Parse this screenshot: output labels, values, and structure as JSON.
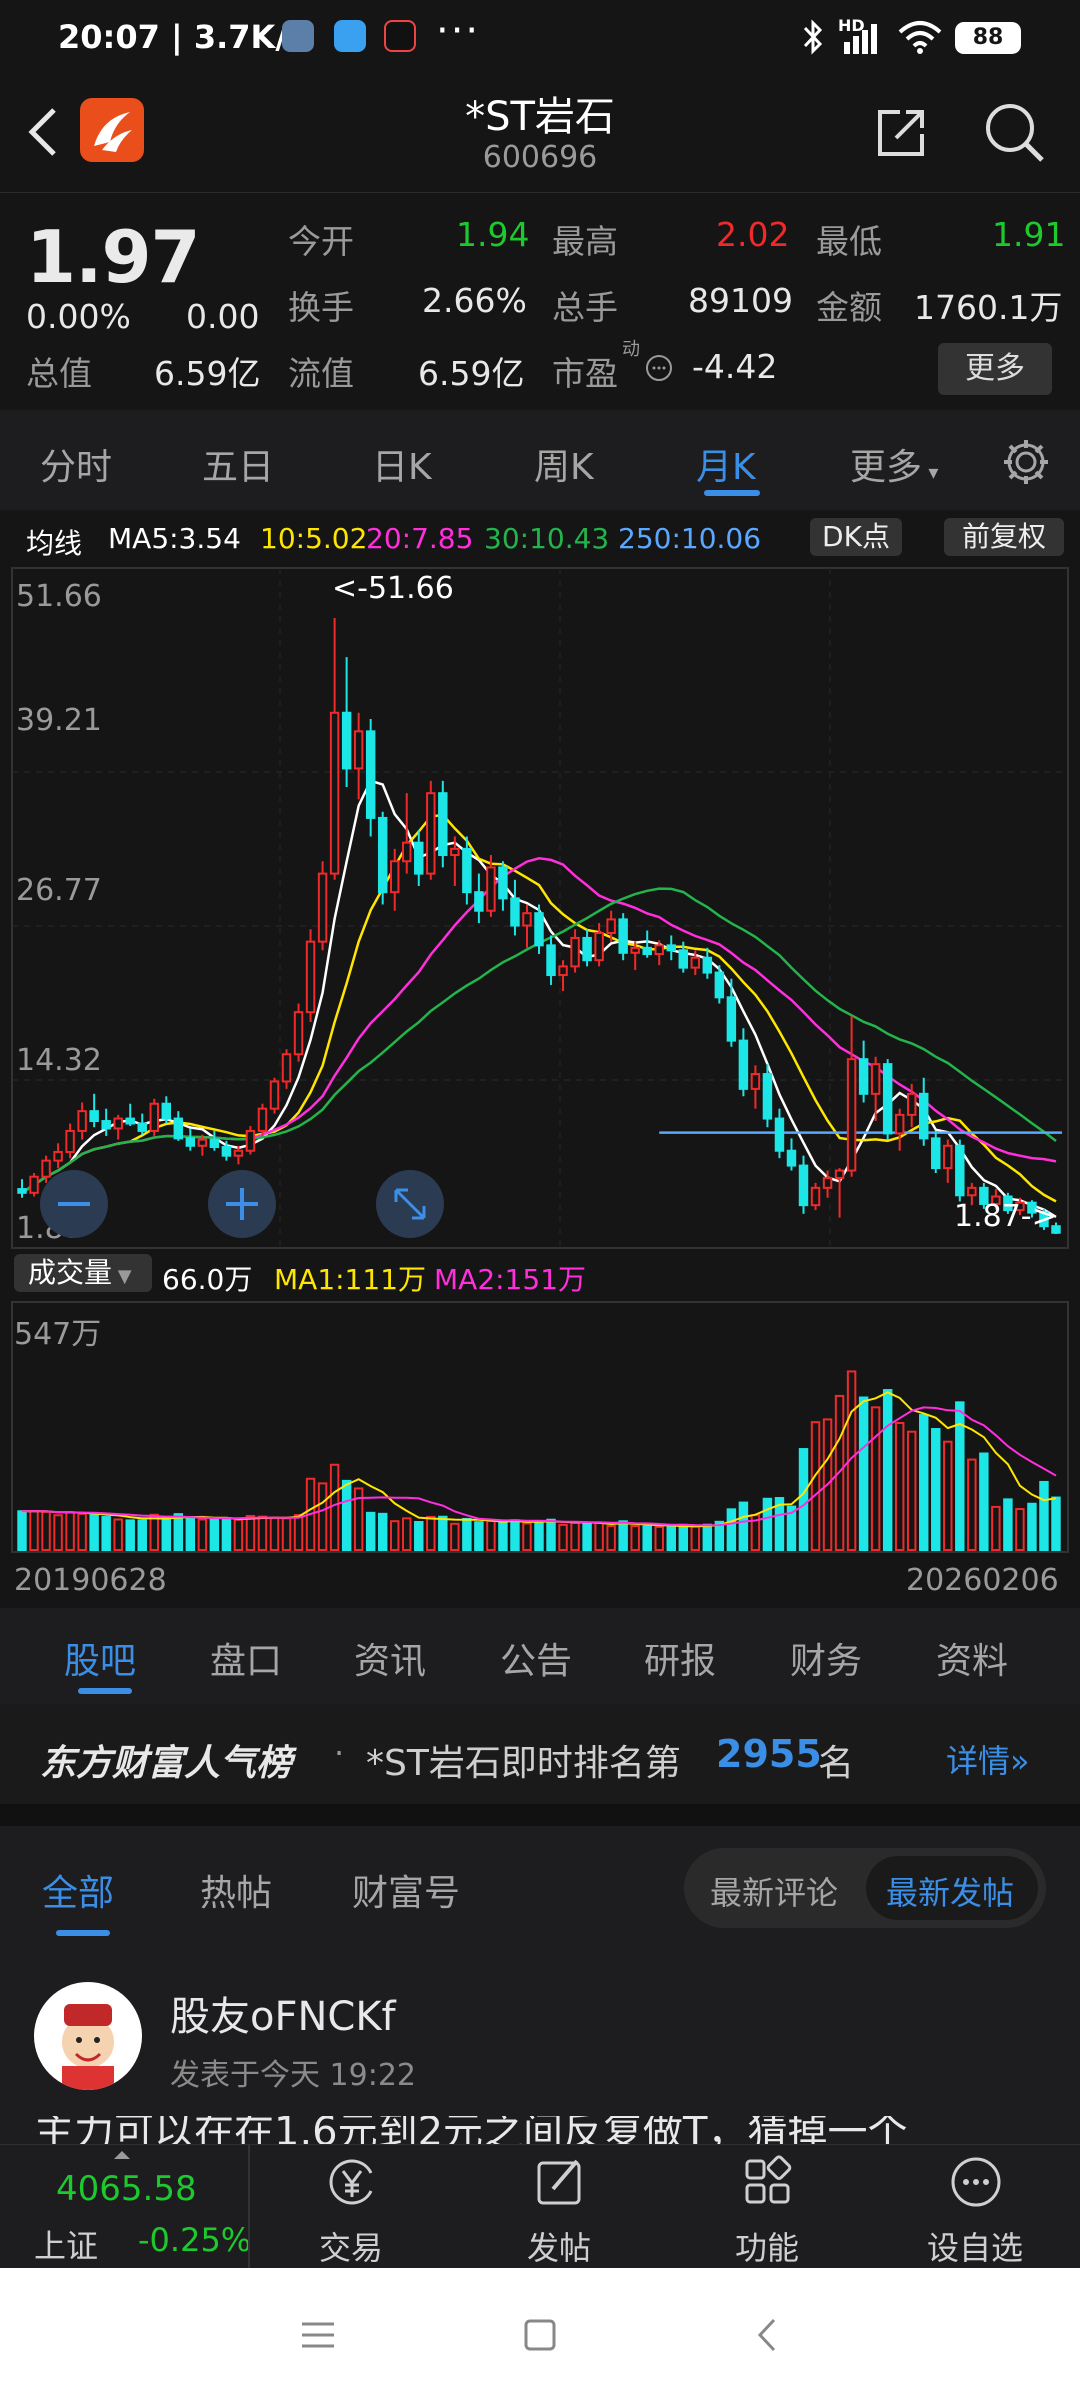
{
  "status": {
    "time": "20:07",
    "speed": "3.7K/s",
    "more": "···",
    "network": "HD",
    "battery": "88"
  },
  "header": {
    "title": "*ST岩石",
    "code": "600696"
  },
  "quote": {
    "price": "1.97",
    "change_pct": "0.00%",
    "change": "0.00",
    "open_label": "今开",
    "open": "1.94",
    "high_label": "最高",
    "high": "2.02",
    "low_label": "最低",
    "low": "1.91",
    "turnover_label": "换手",
    "turnover": "2.66%",
    "volume_label": "总手",
    "volume": "89109",
    "amount_label": "金额",
    "amount": "1760.1万",
    "total_cap_label": "总值",
    "total_cap": "6.59亿",
    "float_cap_label": "流值",
    "float_cap": "6.59亿",
    "pe_label": "市盈",
    "pe_sup": "动",
    "pe": "-4.42",
    "more_label": "更多"
  },
  "chart_tabs": [
    "分时",
    "五日",
    "日K",
    "周K",
    "月K",
    "更多"
  ],
  "chart_tab_active": "月K",
  "ma_legend": {
    "label": "均线",
    "ma5": "MA5:3.54",
    "ma10": "10:5.02",
    "ma20": "20:7.85",
    "ma30": "30:10.43",
    "ma250": "250:10.06",
    "dk_button": "DK点",
    "adjust_button": "前复权"
  },
  "kchart_axis": {
    "t1": "51.66",
    "t2": "39.21",
    "t3": "26.77",
    "t4": "14.32",
    "t5": "1.87",
    "max_mark": "<-51.66",
    "min_mark": "1.87->"
  },
  "volume_legend": {
    "label": "成交量",
    "value": "66.0万",
    "ma1": "MA1:111万",
    "ma2": "MA2:151万",
    "axis_max": "547万",
    "date_start": "20190628",
    "date_end": "20260206"
  },
  "colors": {
    "up": "#f02a2a",
    "down": "#1de6e6",
    "ma5": "#ffffff",
    "ma10": "#ffe600",
    "ma20": "#ff2fdc",
    "ma30": "#23b44b",
    "ma250": "#5aa8ff",
    "accent": "#3b8ee5"
  },
  "chart_data": {
    "type": "candlestick",
    "period": "monthly",
    "ylim": [
      1.87,
      51.66
    ],
    "max": 51.66,
    "min": 1.87,
    "ohlc": [
      [
        5.5,
        6.3,
        4.8,
        5.2
      ],
      [
        5.2,
        6.8,
        4.9,
        6.5
      ],
      [
        6.5,
        8.2,
        6.0,
        7.8
      ],
      [
        7.8,
        9.2,
        7.2,
        8.5
      ],
      [
        8.5,
        10.8,
        8.0,
        10.2
      ],
      [
        10.2,
        12.5,
        9.5,
        11.8
      ],
      [
        11.8,
        13.2,
        10.5,
        11.0
      ],
      [
        11.0,
        12.0,
        9.8,
        10.4
      ],
      [
        10.4,
        11.5,
        9.5,
        11.2
      ],
      [
        11.2,
        12.4,
        10.6,
        10.8
      ],
      [
        10.8,
        11.6,
        9.9,
        10.2
      ],
      [
        10.2,
        12.8,
        9.8,
        12.4
      ],
      [
        12.4,
        13.0,
        10.8,
        11.2
      ],
      [
        11.2,
        11.8,
        9.4,
        9.6
      ],
      [
        9.6,
        10.4,
        8.6,
        9.0
      ],
      [
        9.0,
        9.9,
        8.2,
        9.5
      ],
      [
        9.5,
        10.2,
        8.6,
        8.9
      ],
      [
        8.9,
        9.4,
        7.8,
        8.2
      ],
      [
        8.2,
        9.0,
        7.5,
        8.6
      ],
      [
        8.6,
        10.6,
        8.3,
        10.2
      ],
      [
        10.2,
        12.4,
        9.8,
        12.0
      ],
      [
        12.0,
        14.5,
        11.6,
        14.2
      ],
      [
        14.2,
        16.8,
        13.6,
        16.4
      ],
      [
        16.4,
        20.5,
        15.8,
        19.8
      ],
      [
        19.8,
        26.5,
        19.0,
        25.5
      ],
      [
        25.5,
        32.0,
        24.8,
        31.0
      ],
      [
        31.0,
        51.66,
        30.5,
        44.0
      ],
      [
        44.0,
        48.5,
        38.0,
        39.5
      ],
      [
        39.5,
        44.0,
        37.0,
        42.5
      ],
      [
        42.5,
        43.5,
        34.0,
        35.5
      ],
      [
        35.5,
        36.0,
        28.5,
        29.5
      ],
      [
        29.5,
        33.0,
        28.0,
        32.0
      ],
      [
        32.0,
        37.5,
        31.0,
        33.5
      ],
      [
        33.5,
        34.5,
        30.0,
        31.0
      ],
      [
        31.0,
        38.5,
        30.5,
        37.5
      ],
      [
        37.5,
        38.5,
        31.5,
        32.5
      ],
      [
        32.5,
        34.0,
        30.0,
        33.0
      ],
      [
        33.0,
        34.0,
        28.5,
        29.5
      ],
      [
        29.5,
        31.0,
        27.0,
        28.0
      ],
      [
        28.0,
        32.5,
        27.5,
        31.5
      ],
      [
        31.5,
        32.0,
        28.0,
        29.0
      ],
      [
        29.0,
        30.5,
        26.0,
        26.8
      ],
      [
        26.8,
        28.5,
        25.0,
        27.8
      ],
      [
        27.8,
        28.5,
        24.5,
        25.2
      ],
      [
        25.2,
        26.0,
        22.0,
        22.8
      ],
      [
        22.8,
        24.0,
        21.5,
        23.5
      ],
      [
        23.5,
        26.5,
        23.0,
        25.8
      ],
      [
        25.8,
        26.5,
        23.5,
        24.0
      ],
      [
        24.0,
        27.0,
        23.5,
        26.2
      ],
      [
        26.2,
        28.0,
        25.5,
        27.3
      ],
      [
        27.3,
        27.8,
        24.0,
        24.6
      ],
      [
        24.6,
        25.5,
        23.2,
        25.0
      ],
      [
        25.0,
        26.4,
        24.2,
        24.5
      ],
      [
        24.5,
        25.6,
        23.6,
        25.2
      ],
      [
        25.2,
        26.0,
        24.0,
        24.8
      ],
      [
        24.8,
        25.5,
        23.0,
        23.4
      ],
      [
        23.4,
        24.8,
        22.8,
        24.2
      ],
      [
        24.2,
        25.0,
        22.5,
        23.0
      ],
      [
        23.0,
        23.6,
        20.5,
        21.0
      ],
      [
        21.0,
        22.5,
        17.0,
        17.5
      ],
      [
        17.5,
        18.5,
        13.0,
        13.6
      ],
      [
        13.6,
        15.5,
        12.0,
        14.8
      ],
      [
        14.8,
        15.6,
        10.5,
        11.2
      ],
      [
        11.2,
        12.0,
        8.0,
        8.6
      ],
      [
        8.6,
        9.6,
        7.0,
        7.4
      ],
      [
        7.4,
        8.2,
        3.5,
        4.2
      ],
      [
        4.2,
        6.0,
        3.8,
        5.6
      ],
      [
        5.6,
        7.0,
        4.8,
        6.4
      ],
      [
        6.4,
        7.2,
        3.2,
        7.0
      ],
      [
        7.0,
        19.5,
        6.5,
        16.0
      ],
      [
        16.0,
        17.5,
        12.5,
        13.2
      ],
      [
        13.2,
        16.2,
        11.0,
        15.6
      ],
      [
        15.6,
        16.0,
        9.5,
        10.0
      ],
      [
        10.0,
        12.0,
        8.6,
        11.5
      ],
      [
        11.5,
        14.0,
        10.5,
        13.2
      ],
      [
        13.2,
        14.5,
        9.0,
        9.6
      ],
      [
        9.6,
        10.2,
        6.8,
        7.2
      ],
      [
        7.2,
        9.5,
        6.0,
        9.0
      ],
      [
        9.0,
        9.5,
        4.5,
        5.0
      ],
      [
        5.0,
        6.0,
        4.2,
        5.6
      ],
      [
        5.6,
        6.0,
        3.9,
        4.3
      ],
      [
        4.3,
        5.5,
        3.8,
        4.9
      ],
      [
        4.9,
        5.2,
        3.5,
        3.8
      ],
      [
        3.8,
        4.8,
        3.4,
        4.4
      ],
      [
        4.4,
        4.6,
        3.2,
        3.6
      ],
      [
        3.6,
        3.9,
        2.2,
        2.5
      ],
      [
        2.5,
        2.8,
        1.87,
        1.97
      ]
    ],
    "volume_axis_max": "547万",
    "volume_ma1": "MA1:111万",
    "volume_ma2": "MA2:151万",
    "date_start": "20190628",
    "date_end": "20260206"
  },
  "sections": [
    "股吧",
    "盘口",
    "资讯",
    "公告",
    "研报",
    "财务",
    "资料"
  ],
  "rank": {
    "brand": "东方财富人气榜",
    "dot": "·",
    "text": "*ST岩石即时排名第",
    "rank_value": "2955",
    "unit": "名",
    "detail": "详情"
  },
  "feed_tabs": [
    "全部",
    "热帖",
    "财富号"
  ],
  "sort": {
    "option1": "最新评论",
    "option2": "最新发帖"
  },
  "post": {
    "author": "股友oFNCKf",
    "time": "发表于今天 19:22",
    "preview": "主力可以在在1.6元到2元之间反复做T，猜掉一个"
  },
  "bottom_bar": {
    "index_value": "4065.58",
    "index_name": "上证",
    "index_change": "-0.25%",
    "trade": "交易",
    "post": "发帖",
    "features": "功能",
    "watchlist": "设自选"
  }
}
